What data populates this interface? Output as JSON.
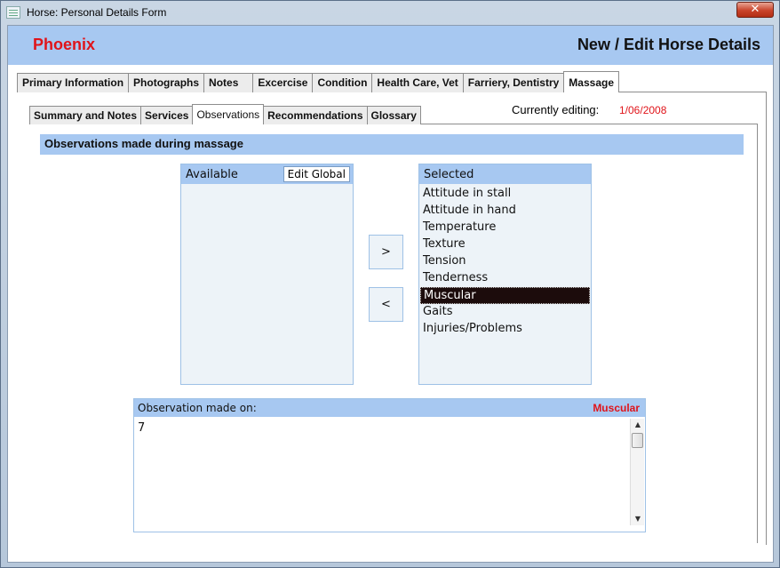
{
  "window": {
    "title": "Horse: Personal Details Form",
    "close_glyph": "✕"
  },
  "header": {
    "horse_name": "Phoenix",
    "form_title": "New / Edit Horse Details"
  },
  "main_tabs": [
    {
      "label": "Primary Information"
    },
    {
      "label": "Photographs"
    },
    {
      "label": "Notes"
    },
    {
      "label": "Excercise"
    },
    {
      "label": "Condition"
    },
    {
      "label": "Health Care, Vet"
    },
    {
      "label": "Farriery, Dentistry"
    },
    {
      "label": "Massage"
    }
  ],
  "sub_tabs": [
    {
      "label": "Summary and Notes"
    },
    {
      "label": "Services"
    },
    {
      "label": "Observations"
    },
    {
      "label": "Recommendations"
    },
    {
      "label": "Glossary"
    }
  ],
  "editing": {
    "label": "Currently editing:",
    "value": "1/06/2008"
  },
  "section": {
    "title": "Observations made during massage"
  },
  "available": {
    "label": "Available",
    "edit_button": "Edit Global",
    "items": []
  },
  "selected": {
    "label": "Selected",
    "items": [
      "Attitude in stall",
      "Attitude in hand",
      "Temperature",
      "Texture",
      "Tension",
      "Tenderness",
      "Muscular",
      "Gaits",
      "Injuries/Problems"
    ],
    "selected_item": "Muscular"
  },
  "buttons": {
    "add": ">",
    "remove": "<"
  },
  "observation": {
    "label": "Observation made on:",
    "current": "Muscular",
    "text": "7"
  },
  "scrollbar": {
    "up_glyph": "▲",
    "down_glyph": "▼"
  }
}
